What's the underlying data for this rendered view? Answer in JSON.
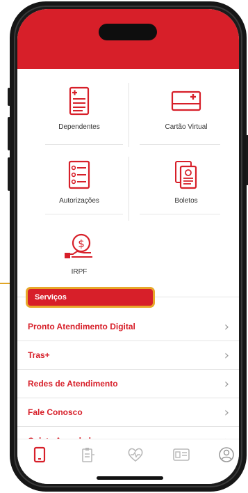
{
  "colors": {
    "brand_red": "#d71f29",
    "highlight": "#e8a72a",
    "chevron": "#9a9a9a"
  },
  "shortcuts": [
    {
      "label": "Dependentes",
      "icon": "document-list-icon"
    },
    {
      "label": "Cartão Virtual",
      "icon": "virtual-card-icon"
    },
    {
      "label": "Autorizações",
      "icon": "checklist-icon"
    },
    {
      "label": "Boletos",
      "icon": "bill-documents-icon"
    },
    {
      "label": "IRPF",
      "icon": "tax-coin-icon"
    }
  ],
  "section": {
    "title": "Serviços"
  },
  "menu": [
    {
      "label": "Pronto Atendimento Digital"
    },
    {
      "label": "Tras+"
    },
    {
      "label": "Redes de Atendimento"
    },
    {
      "label": "Fale Conosco"
    },
    {
      "label": "Coleta Agendada"
    }
  ],
  "tabbar": [
    {
      "icon": "phone-icon",
      "active": true
    },
    {
      "icon": "clipboard-icon",
      "active": false
    },
    {
      "icon": "heart-pulse-icon",
      "active": false
    },
    {
      "icon": "id-card-icon",
      "active": false
    },
    {
      "icon": "profile-icon",
      "active": false
    }
  ]
}
